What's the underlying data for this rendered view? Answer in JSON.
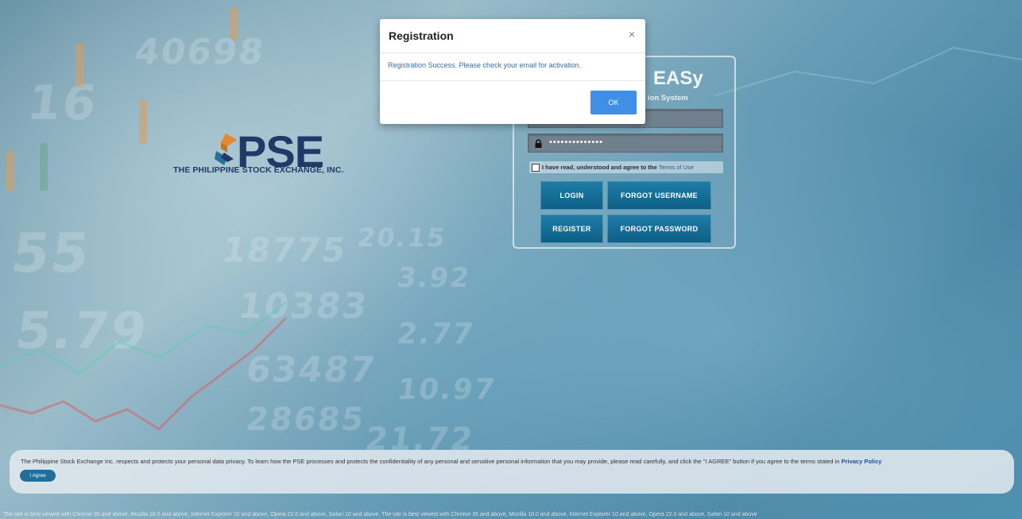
{
  "app": {
    "title": "EASy",
    "subtitle": "ion System"
  },
  "brand": {
    "logo_text": "PSE",
    "logo_subtitle": "THE PHILIPPINE STOCK EXCHANGE, INC.",
    "colors": {
      "navy": "#1f3a66",
      "orange": "#e58a2c",
      "teal": "#2a6f96"
    }
  },
  "login": {
    "password_value": "••••••••••••••",
    "terms_text": "I have read, understood and agree to the",
    "terms_link": "Terms of Use",
    "buttons": {
      "login": "LOGIN",
      "forgot_username": "FORGOT USERNAME",
      "register": "REGISTER",
      "forgot_password": "FORGOT PASSWORD"
    },
    "icons": {
      "lock": "lock-icon"
    }
  },
  "modal": {
    "title": "Registration",
    "close": "×",
    "message": "Registration Success. Please check your email for activation.",
    "ok": "OK"
  },
  "privacy": {
    "text": "The Philippine Stock Exchange Inc. respects and protects your personal data privacy. To learn how the PSE processes and protects the confidentiality of any personal and sensitive personal information that you may provide, please read carefully, and click the \"I AGREE\" button if you agree to the terms stated in",
    "link": "Privacy Policy",
    "agree_button": "I Agree"
  },
  "footer": {
    "text": "The site is best viewed with Chrome 35 and above, Mozilla 18.0 and above, Internet Explorer 10 and above, Opera 22.0 and above, Safari 10 and above. The site is best viewed with Chrome 35 and above, Mozilla 18.0 and above, Internet Explorer 10 and above, Opera 22.0 and above, Safari 10 and above"
  }
}
